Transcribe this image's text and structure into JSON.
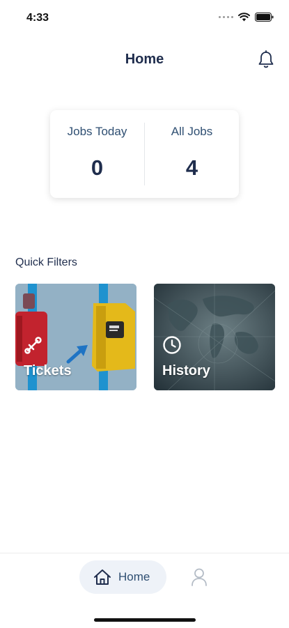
{
  "status_bar": {
    "time": "4:33"
  },
  "header": {
    "title": "Home",
    "icon": "bell-icon"
  },
  "stats": {
    "jobs_today_label": "Jobs Today",
    "jobs_today_value": "0",
    "all_jobs_label": "All Jobs",
    "all_jobs_value": "4"
  },
  "quick_filters": {
    "title": "Quick Filters",
    "tiles": [
      {
        "label": "Tickets",
        "icon": "wrench-icon"
      },
      {
        "label": "History",
        "icon": "clock-icon"
      }
    ]
  },
  "bottom_nav": {
    "items": [
      {
        "label": "Home",
        "icon": "home-icon",
        "active": true
      },
      {
        "label": "",
        "icon": "user-icon",
        "active": false
      }
    ]
  },
  "colors": {
    "primary_text": "#1f2d4d",
    "secondary_text": "#2f4f72",
    "active_nav_bg": "#eef2f8"
  }
}
